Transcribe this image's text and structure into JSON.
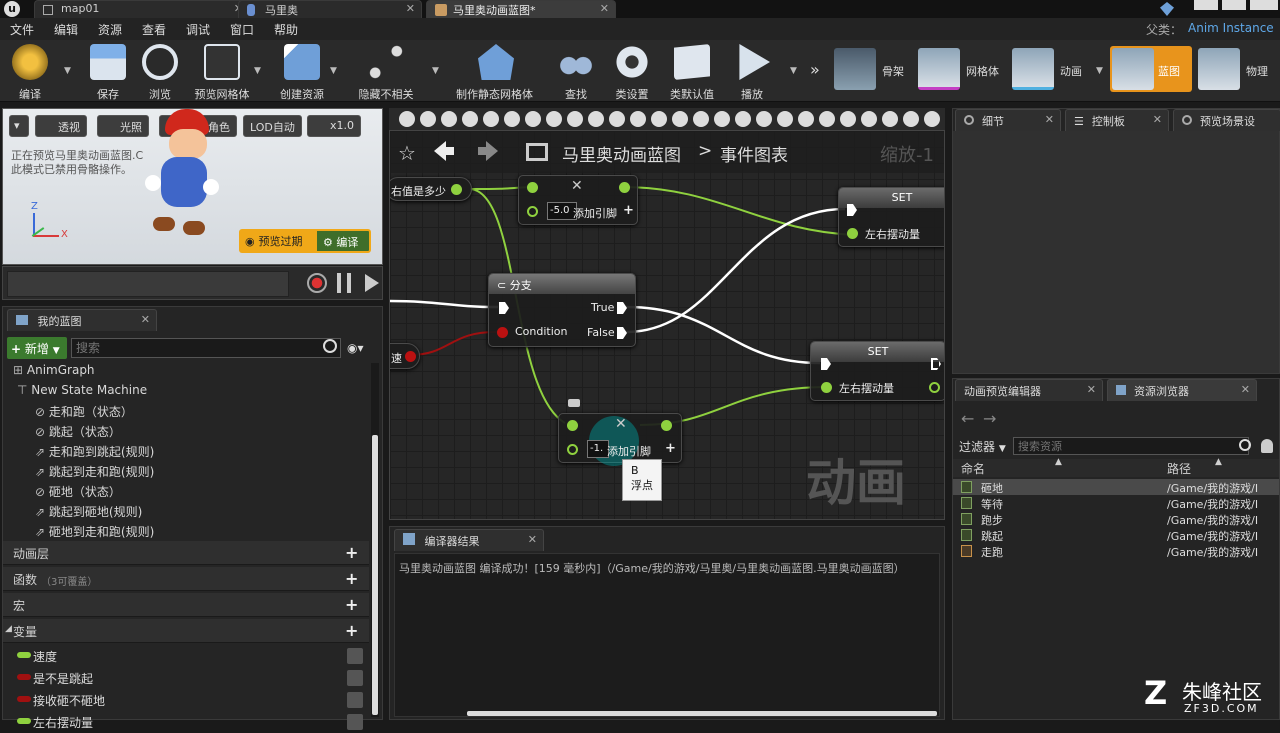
{
  "titlebar": {
    "tabs": [
      {
        "label": "map01"
      },
      {
        "label": "马里奥"
      },
      {
        "label": "马里奥动画蓝图*"
      }
    ],
    "parent_class_label": "父类：",
    "parent_class_value": "Anim Instance"
  },
  "menu": [
    "文件",
    "编辑",
    "资源",
    "查看",
    "调试",
    "窗口",
    "帮助"
  ],
  "toolbar": {
    "buttons": [
      {
        "label": "编译",
        "icon": "compile-gear-icon"
      },
      {
        "label": "保存",
        "icon": "save-disk-icon"
      },
      {
        "label": "浏览",
        "icon": "browse-magnifier-icon"
      },
      {
        "label": "预览网格体",
        "icon": "preview-mesh-icon"
      },
      {
        "label": "创建资源",
        "icon": "create-asset-icon"
      },
      {
        "label": "隐藏不相关",
        "icon": "hide-unrelated-icon"
      },
      {
        "label": "制作静态网格体",
        "icon": "make-static-mesh-icon"
      },
      {
        "label": "查找",
        "icon": "find-binoculars-icon"
      },
      {
        "label": "类设置",
        "icon": "class-settings-icon"
      },
      {
        "label": "类默认值",
        "icon": "class-defaults-icon"
      },
      {
        "label": "播放",
        "icon": "play-icon"
      }
    ],
    "modes": [
      {
        "label": "骨架"
      },
      {
        "label": "网格体"
      },
      {
        "label": "动画"
      },
      {
        "label": "蓝图"
      },
      {
        "label": "物理"
      }
    ]
  },
  "viewport": {
    "chips": [
      "透视",
      "光照",
      "显示",
      "角色",
      "LOD自动",
      "x1.0"
    ],
    "info_line1": "正在预览马里奥动画蓝图.C",
    "info_line2": "此模式已禁用骨骼操作。",
    "axis_z": "Z",
    "axis_x": "X",
    "preview_expired_label": "预览过期",
    "compile_label": "编译"
  },
  "my_blueprint": {
    "tab_label": "我的蓝图",
    "new_label": "新增",
    "search_placeholder": "搜索",
    "tree": [
      {
        "label": "AnimGraph",
        "indent": 0
      },
      {
        "label": "New State Machine",
        "indent": 1
      },
      {
        "label": "走和跑（状态）",
        "indent": 2
      },
      {
        "label": "跳起（状态）",
        "indent": 2
      },
      {
        "label": "走和跑到跳起(规则)",
        "indent": 2
      },
      {
        "label": "跳起到走和跑(规则)",
        "indent": 2
      },
      {
        "label": "砸地（状态）",
        "indent": 2
      },
      {
        "label": "跳起到砸地(规则)",
        "indent": 2
      },
      {
        "label": "砸地到走和跑(规则)",
        "indent": 2
      }
    ],
    "sections": [
      {
        "label": "动画层",
        "note": ""
      },
      {
        "label": "函数",
        "note": "（3可覆盖）"
      },
      {
        "label": "宏",
        "note": ""
      },
      {
        "label": "变量",
        "note": ""
      }
    ],
    "variables": [
      {
        "label": "速度",
        "color": "#8fd13f"
      },
      {
        "label": "是不是跳起",
        "color": "#a01010"
      },
      {
        "label": "接收砸不砸地",
        "color": "#a01010"
      },
      {
        "label": "左右摆动量",
        "color": "#8fd13f"
      }
    ]
  },
  "graph_tab": {
    "breadcrumb_root": "马里奥动画蓝图",
    "breadcrumb_sep": ">",
    "breadcrumb_leaf": "事件图表",
    "zoom_label": "缩放-1",
    "watermark": "动画"
  },
  "graph_nodes": {
    "left_value_label": "右值是多少",
    "add_node_value": "-5.0",
    "add_pin_label": "添加引脚",
    "branch_title": "分支",
    "branch_true": "True",
    "branch_false": "False",
    "branch_condition": "Condition",
    "set_title": "SET",
    "set_var_label": "左右摆动量",
    "speed_stub_label": "速",
    "add2_value": "-1.",
    "add2_pin_label": "添加引脚",
    "tooltip_pin": "B",
    "tooltip_type": "浮点"
  },
  "compiler": {
    "tab_label": "编译器结果",
    "message": "马里奥动画蓝图 编译成功！[159 毫秒内]（/Game/我的游戏/马里奥/马里奥动画蓝图.马里奥动画蓝图）"
  },
  "details_tabs": [
    "细节",
    "控制板",
    "预览场景设"
  ],
  "asset_panel": {
    "tabs": [
      "动画预览编辑器",
      "资源浏览器"
    ],
    "filter_label": "过滤器",
    "search_placeholder": "搜索资源",
    "col_name": "命名",
    "col_path": "路径",
    "rows": [
      {
        "name": "砸地",
        "path": "/Game/我的游戏/I"
      },
      {
        "name": "等待",
        "path": "/Game/我的游戏/I"
      },
      {
        "name": "跑步",
        "path": "/Game/我的游戏/I"
      },
      {
        "name": "跳起",
        "path": "/Game/我的游戏/I"
      },
      {
        "name": "走跑",
        "path": "/Game/我的游戏/I"
      }
    ]
  },
  "watermark": {
    "brand": "朱峰社区",
    "site": "ZF3D.COM"
  }
}
